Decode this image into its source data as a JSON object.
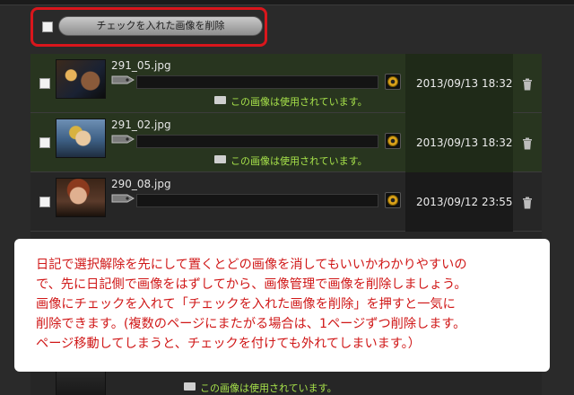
{
  "toolbar": {
    "delete_checked_label": "チェックを入れた画像を削除"
  },
  "rows": [
    {
      "filename": "291_05.jpg",
      "date": "2013/09/13 18:32",
      "status": "この画像は使用されています。",
      "used": true
    },
    {
      "filename": "291_02.jpg",
      "date": "2013/09/13 18:32",
      "status": "この画像は使用されています。",
      "used": true
    },
    {
      "filename": "290_08.jpg",
      "date": "2013/09/12 23:55",
      "status": "",
      "used": false
    }
  ],
  "bottom_row": {
    "status": "この画像は使用されています。"
  },
  "callout": {
    "lines": [
      "日記で選択解除を先にして置くとどの画像を消してもいいかわかりやすいの",
      "で、先に日記側で画像をはずしてから、画像管理で画像を削除しましょう。",
      "画像にチェックを入れて「チェックを入れた画像を削除」を押すと一気に",
      "削除できます。(複数のページにまたがる場合は、1ページずつ削除します。",
      "ページ移動してしまうと、チェックを付けても外れてしまいます。）"
    ]
  },
  "colors": {
    "highlight": "#d9161c",
    "status_text": "#a6e14a",
    "callout_text": "#d01818"
  }
}
